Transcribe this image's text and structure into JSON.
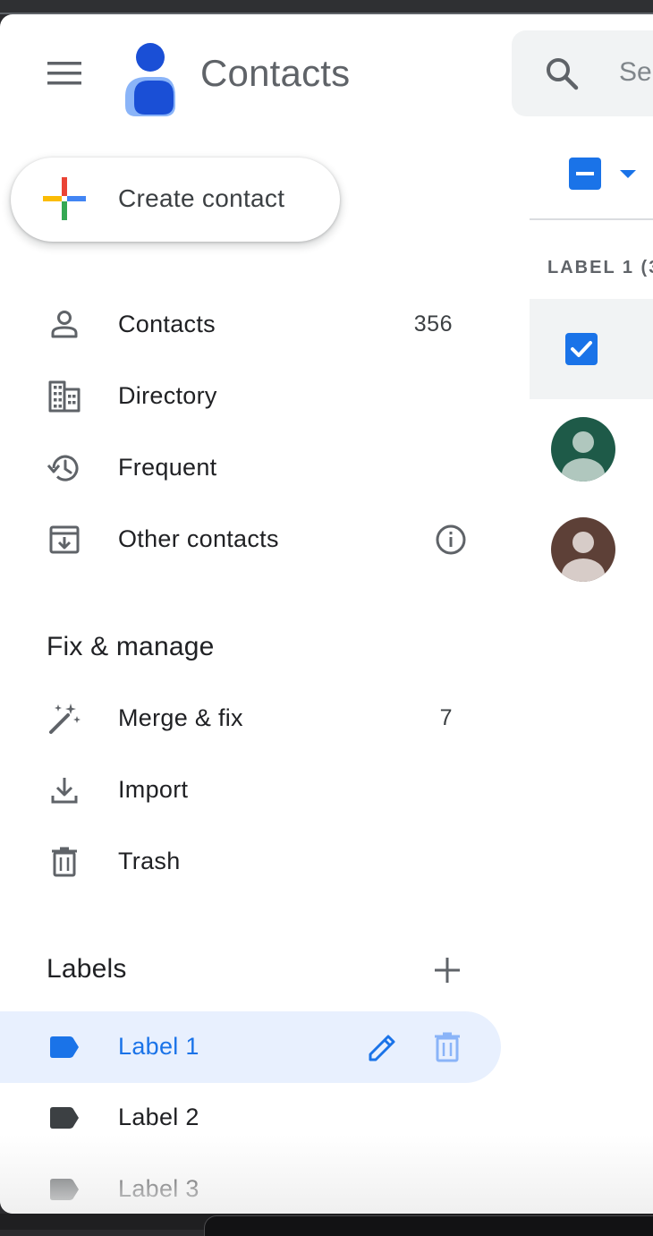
{
  "header": {
    "app_title": "Contacts",
    "menu_icon": "hamburger-menu-icon",
    "logo_icon": "contacts-logo-icon",
    "search_placeholder": "Se"
  },
  "create_button": {
    "label": "Create contact",
    "icon": "colorful-plus-icon"
  },
  "nav": {
    "items": [
      {
        "label": "Contacts",
        "count": "356",
        "icon": "person-icon"
      },
      {
        "label": "Directory",
        "icon": "building-icon"
      },
      {
        "label": "Frequent",
        "icon": "history-icon"
      },
      {
        "label": "Other contacts",
        "icon": "archive-download-icon",
        "trailing_icon": "info-icon"
      }
    ]
  },
  "fix_manage": {
    "title": "Fix & manage",
    "items": [
      {
        "label": "Merge & fix",
        "count": "7",
        "icon": "magic-wand-icon"
      },
      {
        "label": "Import",
        "icon": "download-icon"
      },
      {
        "label": "Trash",
        "icon": "trash-icon"
      }
    ]
  },
  "labels": {
    "title": "Labels",
    "add_icon": "plus-icon",
    "items": [
      {
        "label": "Label 1",
        "active": true,
        "icon": "label-tag-icon"
      },
      {
        "label": "Label 2",
        "icon": "label-tag-icon"
      },
      {
        "label": "Label 3",
        "icon": "label-tag-icon"
      }
    ]
  },
  "list": {
    "header": "LABEL 1 (3",
    "avatars": [
      {
        "bg": "#1e5a48",
        "fg": "#b0c7be"
      },
      {
        "bg": "#5d4037",
        "fg": "#d7ccc8"
      }
    ]
  },
  "colors": {
    "accent": "#1a73e8",
    "active_bg": "#e8f0fe",
    "text_primary": "#202124",
    "text_secondary": "#5f6368"
  }
}
